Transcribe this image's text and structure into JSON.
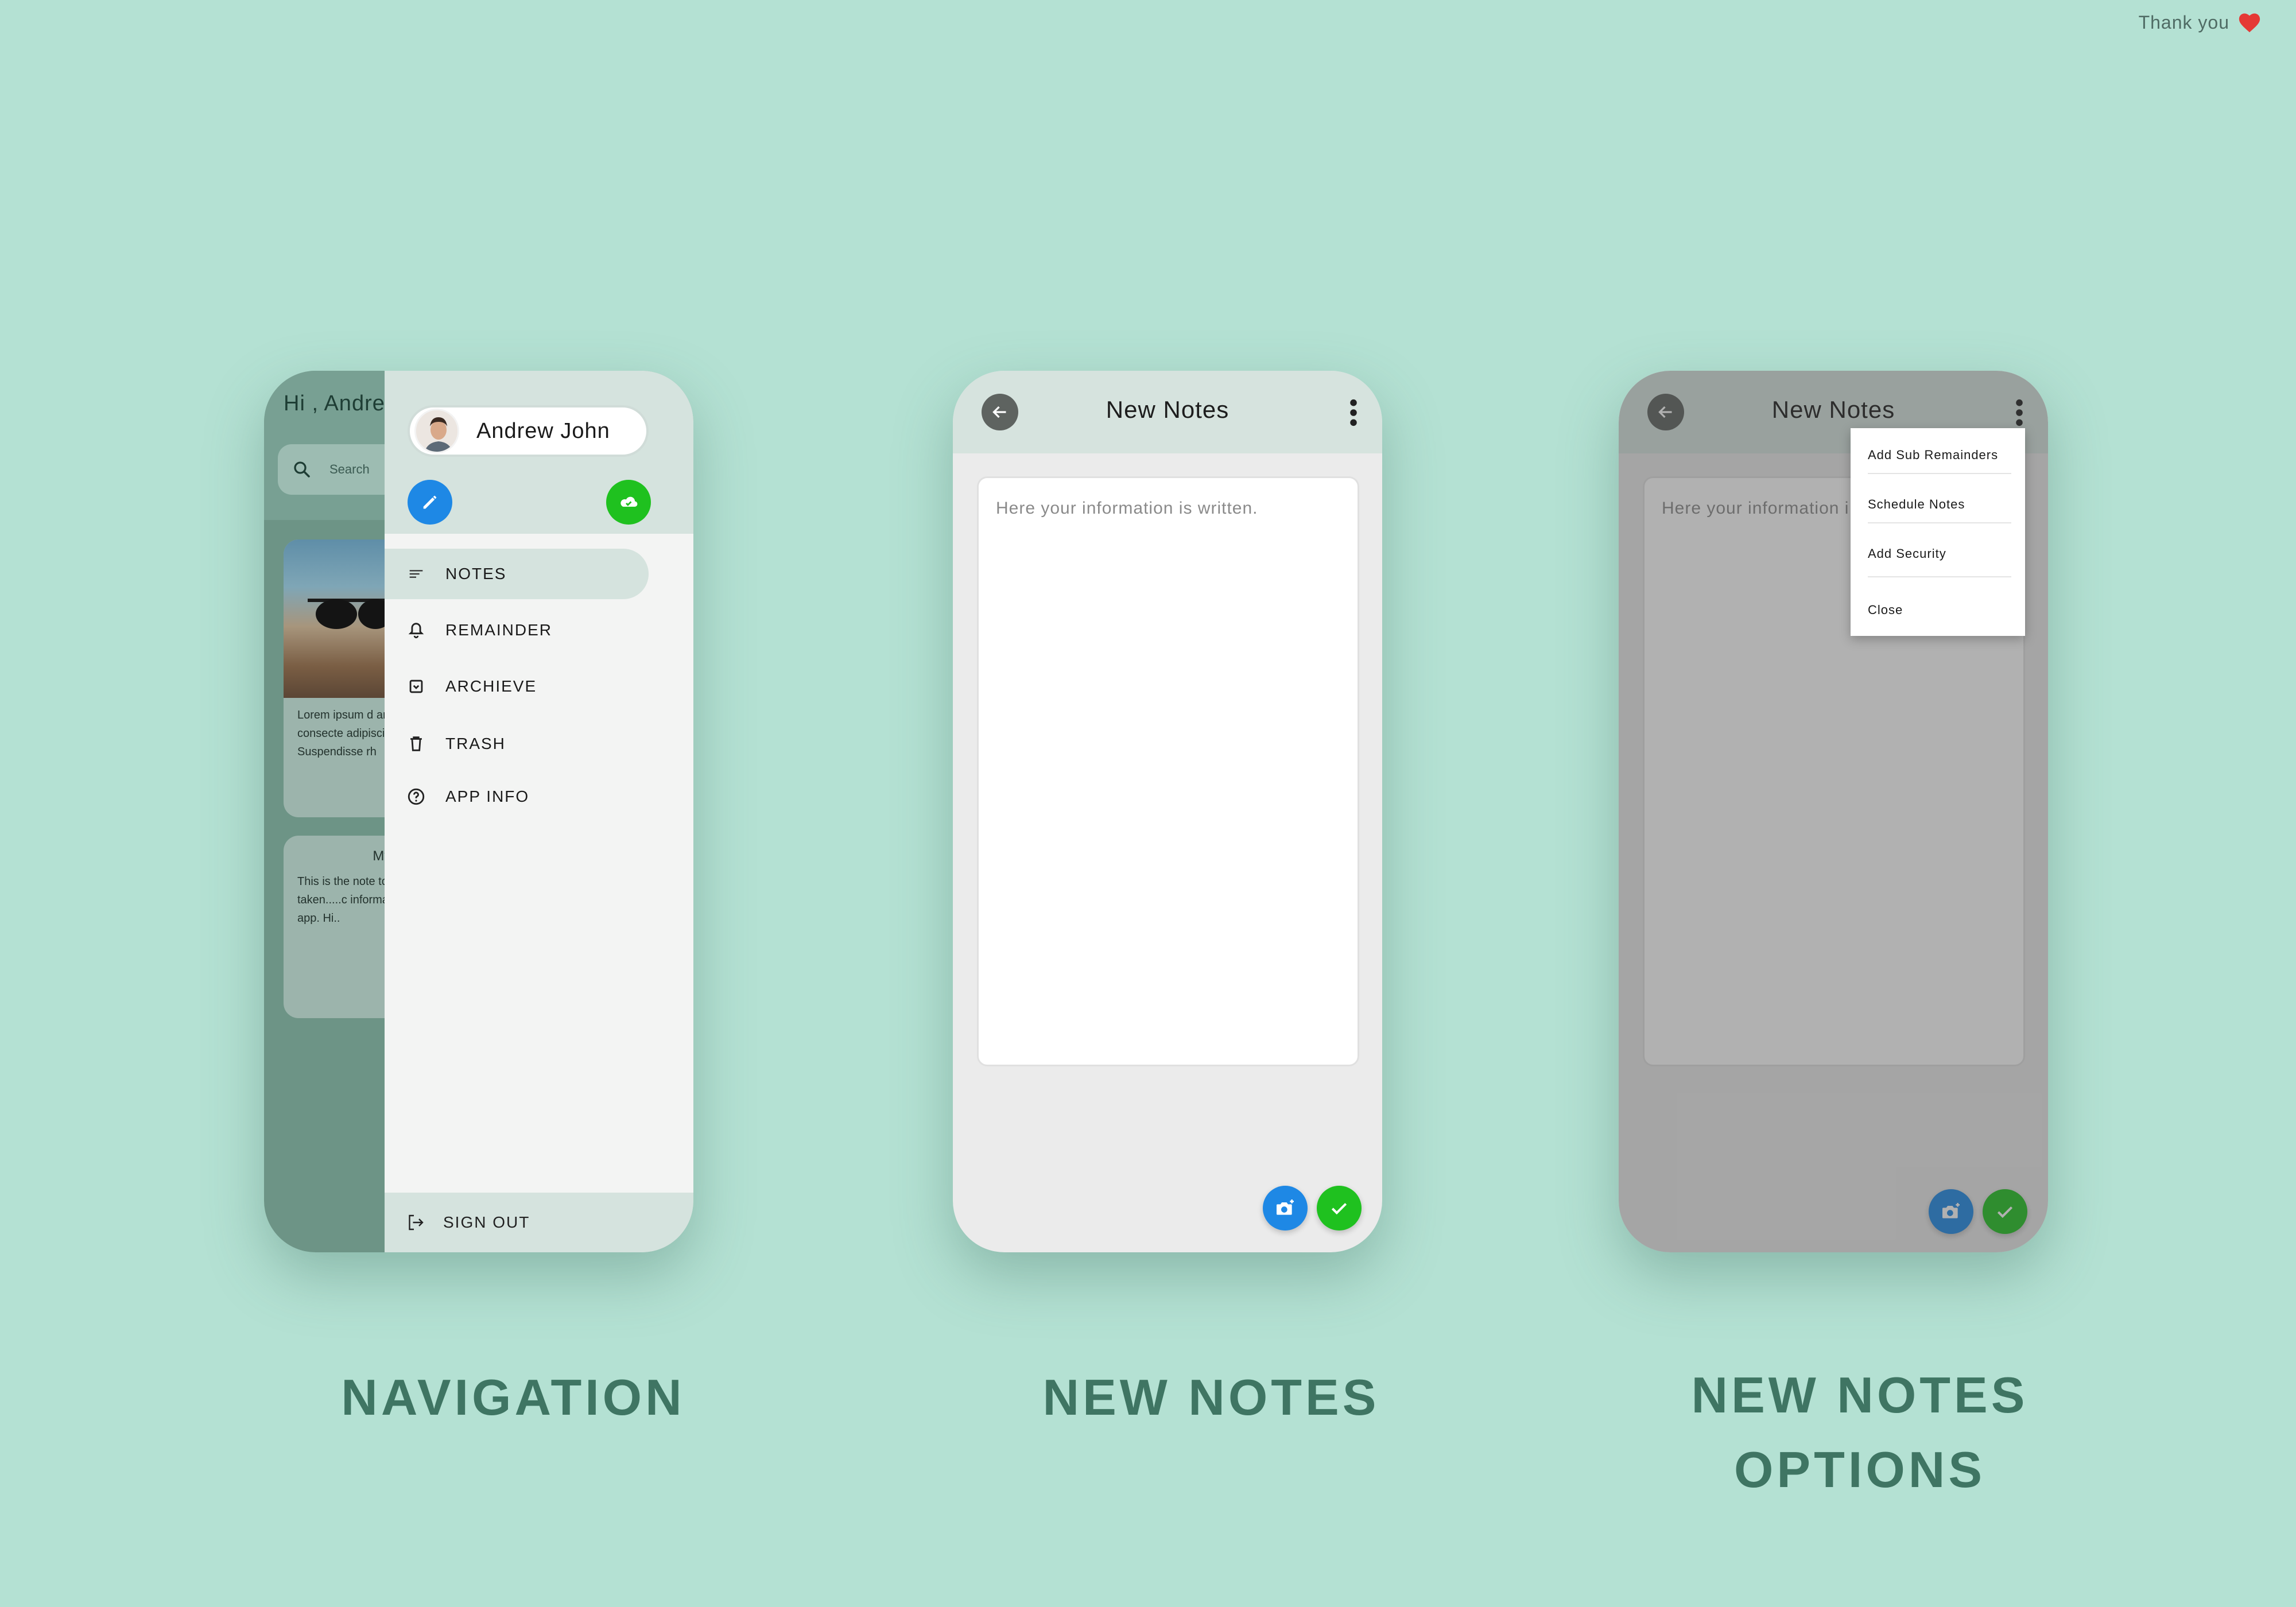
{
  "thanks": {
    "text": "Thank you",
    "heart_icon": "heart-icon",
    "heart_color": "#e53935"
  },
  "captions": {
    "navigation": "NAVIGATION",
    "new_notes": "NEW NOTES",
    "new_notes_options_line1": "NEW NOTES",
    "new_notes_options_line2": "OPTIONS"
  },
  "navigation_screen": {
    "background": {
      "greeting": "Hi , Andre",
      "search_placeholder": "Search",
      "card1_text": "Lorem ipsum d amet, consecte adipiscing elit. Suspendisse rh",
      "card2_title": "My No",
      "card2_text": "This is the note to be taken.....c information to app. Hi.."
    },
    "drawer": {
      "profile_name": "Andrew John",
      "edit_button_icon": "pencil-icon",
      "sync_button_icon": "cloud-check-icon",
      "items": [
        {
          "label": "NOTES",
          "icon": "notes-lines-icon",
          "active": true
        },
        {
          "label": "REMAINDER",
          "icon": "bell-icon",
          "active": false
        },
        {
          "label": "ARCHIEVE",
          "icon": "archive-icon",
          "active": false
        },
        {
          "label": "TRASH",
          "icon": "trash-icon",
          "active": false
        },
        {
          "label": "APP INFO",
          "icon": "help-circle-icon",
          "active": false
        }
      ],
      "sign_out": "SIGN OUT"
    }
  },
  "new_notes_screen": {
    "title": "New Notes",
    "placeholder": "Here your information is written.",
    "camera_icon": "add-photo-icon",
    "confirm_icon": "check-icon"
  },
  "options_screen": {
    "title": "New Notes",
    "placeholder_visible": "Here your information i",
    "menu": [
      "Add Sub Remainders",
      "Schedule Notes",
      "Add Security",
      "Close"
    ]
  },
  "colors": {
    "background": "#b4e1d3",
    "caption": "#3f7563",
    "blue_fab": "#1e88e5",
    "green_fab": "#1fc11f"
  }
}
